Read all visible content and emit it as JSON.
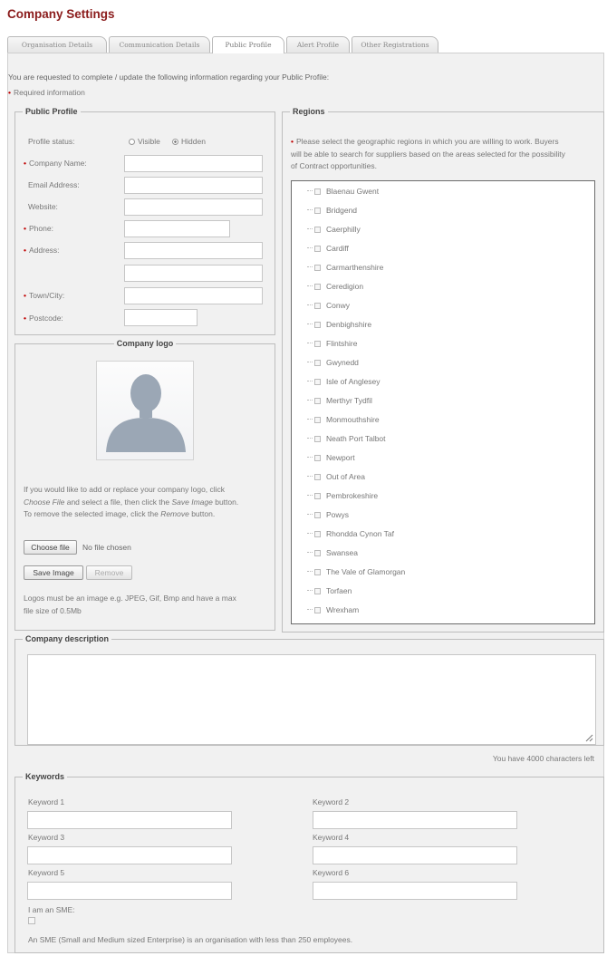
{
  "page": {
    "title": "Company Settings"
  },
  "tabs": [
    "Organisation Details",
    "Communication Details",
    "Public Profile",
    "Alert Profile",
    "Other Registrations"
  ],
  "active_tab": "Public Profile",
  "intro": "You are requested to complete / update the following information regarding your Public Profile:",
  "required_note": "Required information",
  "public_profile": {
    "legend": "Public Profile",
    "status_label": "Profile status:",
    "status_options": [
      "Visible",
      "Hidden"
    ],
    "status_selected": "Hidden",
    "fields": {
      "company_name": "Company Name:",
      "email": "Email Address:",
      "website": "Website:",
      "phone": "Phone:",
      "address": "Address:",
      "town": "Town/City:",
      "postcode": "Postcode:"
    }
  },
  "company_logo": {
    "legend": "Company logo",
    "instructions_line1": "If you would like to add or replace your company logo, click",
    "instructions_line2_pre": "Choose File",
    "instructions_line2_mid": " and select a file, then click the ",
    "instructions_line2_em": "Save Image",
    "instructions_line2_post": " button.",
    "instructions_line3_pre": "To remove the selected image, click the ",
    "instructions_line3_em": "Remove",
    "instructions_line3_post": " button.",
    "choose_file": "Choose file",
    "no_file": "No file chosen",
    "save_image": "Save Image",
    "remove": "Remove",
    "note_line1": "Logos must be an image e.g. JPEG, Gif, Bmp and have a max",
    "note_line2": "file size of 0.5Mb"
  },
  "regions": {
    "legend": "Regions",
    "help_line1": "Please select the geographic regions in which you are willing to work. Buyers",
    "help_line2": "will be able to search for suppliers based on the areas selected for the possibility",
    "help_line3": "of Contract opportunities.",
    "items": [
      "Blaenau Gwent",
      "Bridgend",
      "Caerphilly",
      "Cardiff",
      "Carmarthenshire",
      "Ceredigion",
      "Conwy",
      "Denbighshire",
      "Flintshire",
      "Gwynedd",
      "Isle of Anglesey",
      "Merthyr Tydfil",
      "Monmouthshire",
      "Neath Port Talbot",
      "Newport",
      "Out of Area",
      "Pembrokeshire",
      "Powys",
      "Rhondda Cynon Taf",
      "Swansea",
      "The Vale of Glamorgan",
      "Torfaen",
      "Wrexham"
    ]
  },
  "company_description": {
    "legend": "Company description",
    "chars_left": "You have 4000 characters left"
  },
  "keywords": {
    "legend": "Keywords",
    "labels": [
      "Keyword 1",
      "Keyword 2",
      "Keyword 3",
      "Keyword 4",
      "Keyword 5",
      "Keyword 6"
    ],
    "sme_label": "I am an SME:",
    "sme_note": "An SME (Small and Medium sized Enterprise) is an organisation with less than 250 employees."
  }
}
